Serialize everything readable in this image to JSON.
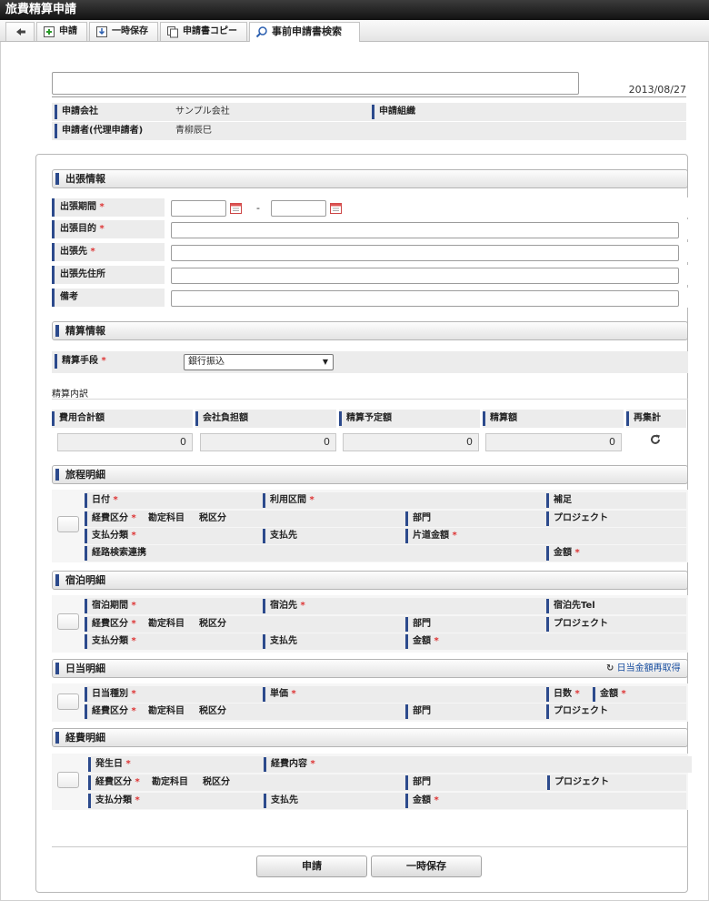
{
  "window": {
    "title": "旅費精算申請"
  },
  "toolbar": {
    "back_label": "",
    "apply": "申請",
    "save_temp": "一時保存",
    "copy": "申請書コピー",
    "search_prior": "事前申請書検索"
  },
  "header": {
    "subject_value": "",
    "date": "2013/08/27",
    "company_label": "申請会社",
    "company_value": "サンプル会社",
    "org_label": "申請組織",
    "org_value": "",
    "applicant_label": "申請者(代理申請者)",
    "applicant_value": "青柳辰巳"
  },
  "trip": {
    "section_title": "出張情報",
    "period_label": "出張期間",
    "period_separator": "-",
    "purpose_label": "出張目的",
    "destination_label": "出張先",
    "dest_address_label": "出張先住所",
    "remarks_label": "備考",
    "required_mark": "*"
  },
  "settlement": {
    "section_title": "精算情報",
    "method_label": "精算手段",
    "method_selected": "銀行振込",
    "breakdown_label": "精算内訳",
    "col_total": "費用合計額",
    "col_company": "会社負担額",
    "col_planned": "精算予定額",
    "col_amount": "精算額",
    "col_recalc": "再集計",
    "val_total": "0",
    "val_company": "0",
    "val_planned": "0",
    "val_amount": "0"
  },
  "itinerary": {
    "section_title": "旅程明細",
    "date": "日付",
    "route": "利用区間",
    "supplement": "補足",
    "expense_type": "経費区分",
    "account": "勘定科目",
    "tax": "税区分",
    "dept": "部門",
    "project": "プロジェクト",
    "payment_type": "支払分類",
    "payee": "支払先",
    "one_way": "片道金額",
    "route_search": "経路検索連携",
    "amount": "金額"
  },
  "lodging": {
    "section_title": "宿泊明細",
    "period": "宿泊期間",
    "place": "宿泊先",
    "tel": "宿泊先Tel",
    "expense_type": "経費区分",
    "account": "勘定科目",
    "tax": "税区分",
    "dept": "部門",
    "project": "プロジェクト",
    "payment_type": "支払分類",
    "payee": "支払先",
    "amount": "金額"
  },
  "daily": {
    "section_title": "日当明細",
    "refetch": "日当金額再取得",
    "kind": "日当種別",
    "unit_price": "単価",
    "days": "日数",
    "amount": "金額",
    "expense_type": "経費区分",
    "account": "勘定科目",
    "tax": "税区分",
    "dept": "部門",
    "project": "プロジェクト"
  },
  "expense": {
    "section_title": "経費明細",
    "date": "発生日",
    "content": "経費内容",
    "expense_type": "経費区分",
    "account": "勘定科目",
    "tax": "税区分",
    "dept": "部門",
    "project": "プロジェクト",
    "payment_type": "支払分類",
    "payee": "支払先",
    "amount": "金額"
  },
  "footer": {
    "apply_button": "申請",
    "save_button": "一時保存"
  },
  "colors": {
    "accent": "#2c4a8c",
    "required": "#dd3333",
    "link": "#1a4fa0"
  }
}
